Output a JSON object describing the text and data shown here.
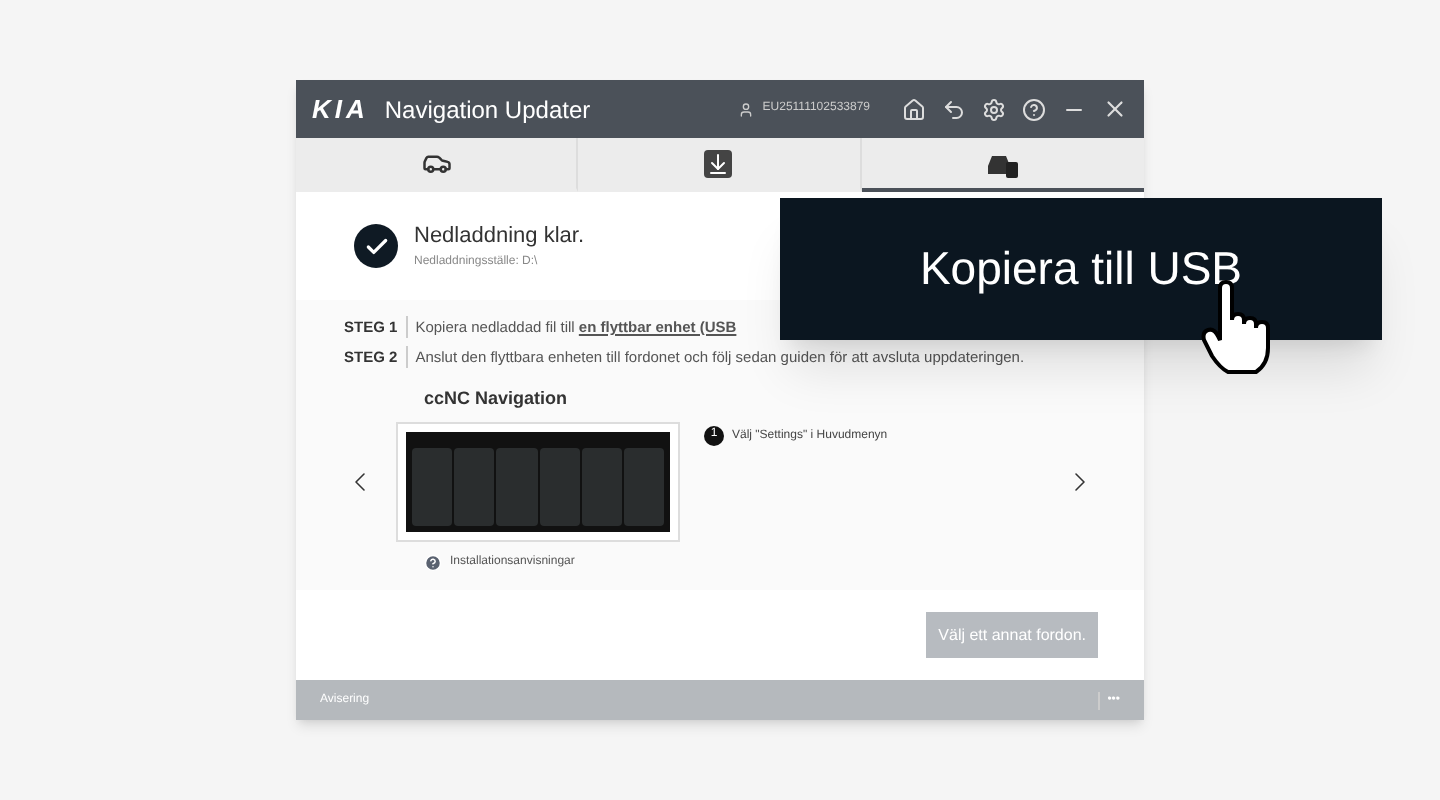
{
  "window": {
    "logo": "KIA",
    "title": "Navigation Updater",
    "user_id": "EU25111102533879"
  },
  "steps": [
    {
      "kind": "vehicle",
      "selected": false
    },
    {
      "kind": "download",
      "selected": false
    },
    {
      "kind": "transfer",
      "selected": true
    }
  ],
  "status": {
    "title": "Nedladdning klar.",
    "location": "Nedladdningsställe: D:\\"
  },
  "instructions": [
    {
      "label": "STEG 1",
      "text": "Kopiera nedladdad fil till ",
      "link": "en flyttbar enhet (USB"
    },
    {
      "label": "STEG 2",
      "text": "Anslut den flyttbara enheten till fordonet och följ sedan guiden för att avsluta uppdateringen."
    }
  ],
  "guide": {
    "title": "ccNC Navigation",
    "step_number": "1",
    "step_text": "Välj \"Settings\" i Huvudmenyn",
    "help_link": "Installationsanvisningar"
  },
  "actions": {
    "secondary": "Välj ett annat fordon."
  },
  "status_bar": {
    "label": "Avisering",
    "menu": "•••"
  },
  "callout": {
    "label": "Kopiera till USB"
  }
}
